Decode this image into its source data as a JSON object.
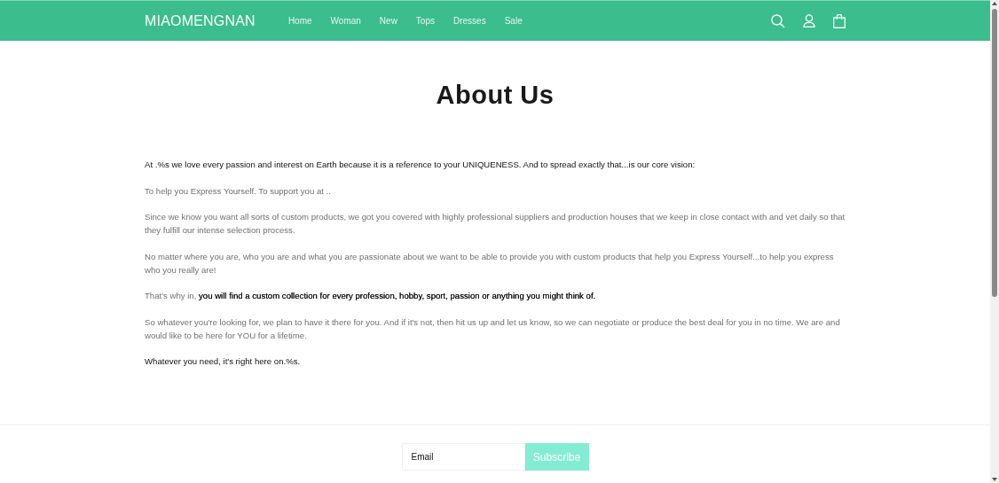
{
  "header": {
    "logo": "MIAOMENGNAN",
    "nav": [
      {
        "label": "Home"
      },
      {
        "label": "Woman"
      },
      {
        "label": "New"
      },
      {
        "label": "Tops"
      },
      {
        "label": "Dresses"
      },
      {
        "label": "Sale"
      }
    ]
  },
  "page": {
    "title": "About Us",
    "paragraphs": [
      {
        "text": "At .%s we love every passion and interest on Earth because it is a reference to your UNIQUENESS. And to spread exactly that...is our core vision:",
        "bold": true
      },
      {
        "text": "To help you Express Yourself. To support you at ..",
        "bold": false
      },
      {
        "text": "Since we know you want all sorts of custom products, we got you covered with highly professional suppliers and production houses that we keep in close contact with and vet daily so that they fulfill our intense selection process.",
        "bold": false
      },
      {
        "text": "No matter where you are, who you are and what you are passionate about we want to be able to provide you with custom products that help you Express Yourself...to help you express who you really are!",
        "bold": false
      },
      {
        "text": "That's why in, **you will find a custom collection for every profession, hobby, sport, passion or anything you might think of.**",
        "bold": false
      },
      {
        "text": "So whatever you're looking for, we plan to have it there for you. And if it's not, then hit us up and let us know, so we can negotiate or produce the best deal for you in no time. We are and would like to be here for YOU for a lifetime.",
        "bold": false
      },
      {
        "text": "Whatever you need, it's right here on.%s.",
        "bold": true
      }
    ]
  },
  "footer": {
    "email": {
      "placeholder": "Email"
    },
    "subscribe": "Subscribe"
  }
}
